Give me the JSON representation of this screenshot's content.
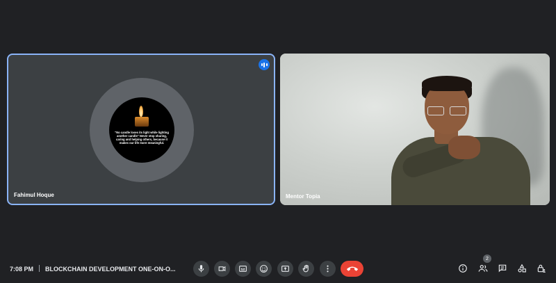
{
  "participants": [
    {
      "name": "Fahimul Hoque",
      "speaking": true,
      "avatar_quote": "\"No candle loses its light while lighting another candle\" Never stop sharing, caring and helping others, because it makes our life more meaningful."
    },
    {
      "name": "Mentor Topia",
      "speaking": false
    }
  ],
  "meeting": {
    "time": "7:08 PM",
    "title": "BLOCKCHAIN DEVELOPMENT ONE-ON-O..."
  },
  "controls": {
    "mic": "microphone-icon",
    "camera": "camera-icon",
    "captions": "captions-icon",
    "reactions": "emoji-icon",
    "present": "present-screen-icon",
    "raise_hand": "raise-hand-icon",
    "more": "more-options-icon",
    "leave": "end-call-icon"
  },
  "side_controls": {
    "people_count": "2"
  },
  "colors": {
    "background": "#202124",
    "tile": "#3c4043",
    "active_border": "#8ab4f8",
    "end_call": "#ea4335",
    "speaking_indicator": "#1a73e8"
  }
}
